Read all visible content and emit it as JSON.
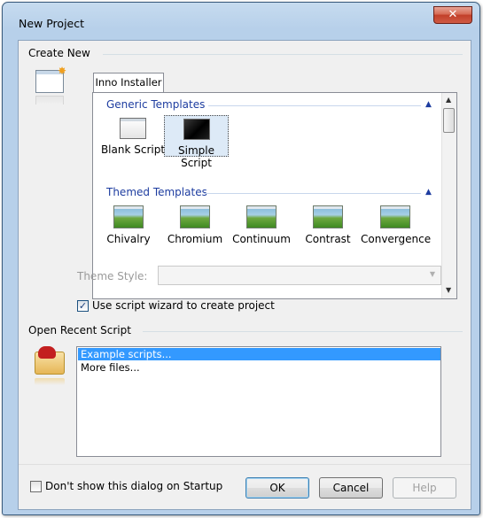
{
  "window": {
    "title": "New Project",
    "close_glyph": "✕"
  },
  "create_new": {
    "section_label": "Create New",
    "tab_label": "Inno Installer",
    "generic_header": "Generic Templates",
    "generic_items": [
      "Blank Script",
      "Simple Script"
    ],
    "selected_generic": "Simple Script",
    "themed_header": "Themed Templates",
    "themed_items": [
      "Chivalry",
      "Chromium",
      "Continuum",
      "Contrast",
      "Convergence"
    ],
    "theme_style_label": "Theme Style:",
    "theme_style_value": "",
    "wizard_checkbox_label": "Use script wizard to create project",
    "wizard_checked": true
  },
  "open_recent": {
    "section_label": "Open Recent Script",
    "items": [
      "Example scripts...",
      "More files..."
    ],
    "selected_item": "Example scripts..."
  },
  "footer": {
    "startup_checkbox_label": "Don't show this dialog on Startup",
    "startup_checked": false,
    "ok_label": "OK",
    "cancel_label": "Cancel",
    "help_label": "Help"
  },
  "icons": {
    "collapse": "▲",
    "scroll_up": "▲",
    "scroll_down": "▼",
    "dropdown": "▼",
    "check": "✓"
  }
}
